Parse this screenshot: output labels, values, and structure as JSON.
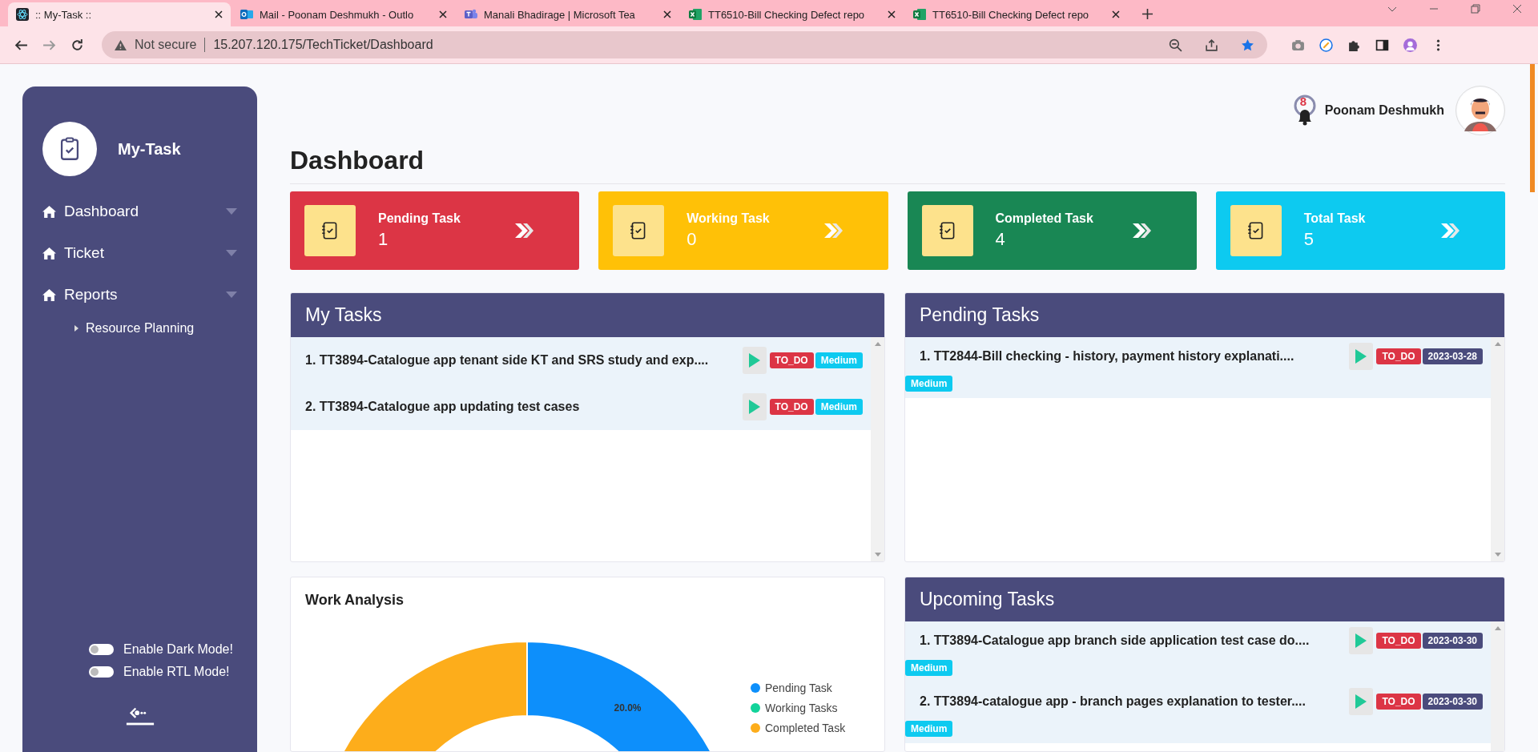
{
  "browser": {
    "tabs": [
      {
        "title": ":: My-Task ::",
        "kind": "app",
        "selected": true
      },
      {
        "title": "Mail - Poonam Deshmukh - Outlo",
        "kind": "mail",
        "selected": false
      },
      {
        "title": "Manali Bhadirage | Microsoft Tea",
        "kind": "chat",
        "selected": false
      },
      {
        "title": "TT6510-Bill Checking Defect repo",
        "kind": "sheet",
        "selected": false
      },
      {
        "title": "TT6510-Bill Checking Defect repo",
        "kind": "sheet",
        "selected": false
      }
    ],
    "security": "Not secure",
    "url": "15.207.120.175/TechTicket/Dashboard"
  },
  "sidebar": {
    "brand": "My-Task",
    "nav": [
      {
        "label": "Dashboard"
      },
      {
        "label": "Ticket"
      },
      {
        "label": "Reports",
        "children": [
          {
            "label": "Resource Planning"
          }
        ]
      }
    ],
    "toggles": [
      {
        "label": "Enable Dark Mode!",
        "on": false
      },
      {
        "label": "Enable RTL Mode!",
        "on": false
      }
    ]
  },
  "header": {
    "notifications": "8",
    "user": "Poonam Deshmukh"
  },
  "title": "Dashboard",
  "stat_cards": [
    {
      "label": "Pending Task",
      "value": "1",
      "color": "#dc3545"
    },
    {
      "label": "Working Task",
      "value": "0",
      "color": "#ffc107"
    },
    {
      "label": "Completed Task",
      "value": "4",
      "color": "#198754"
    },
    {
      "label": "Total Task",
      "value": "5",
      "color": "#0dcaf0"
    }
  ],
  "my_tasks": {
    "title": "My Tasks",
    "tasks": [
      {
        "title": "1. TT3894-Catalogue app tenant side KT and SRS study and exp....",
        "status": "TO_DO",
        "priority": "Medium"
      },
      {
        "title": "2. TT3894-Catalogue app updating test cases",
        "status": "TO_DO",
        "priority": "Medium"
      }
    ]
  },
  "pending_tasks": {
    "title": "Pending Tasks",
    "tasks": [
      {
        "title": "1. TT2844-Bill checking - history, payment history explanati....",
        "status": "TO_DO",
        "date": "2023-03-28",
        "priority": "Medium"
      }
    ]
  },
  "work_analysis": {
    "title": "Work Analysis",
    "chart_data": {
      "type": "donut",
      "legend": true,
      "categories": [
        "Pending Task",
        "Working Tasks",
        "Completed Task"
      ],
      "values": [
        20,
        0,
        80
      ],
      "colors": [
        "#0d8ffb",
        "#12d39a",
        "#fdad1b"
      ],
      "value_labels": [
        "20.0%",
        null,
        null
      ]
    }
  },
  "upcoming_tasks": {
    "title": "Upcoming Tasks",
    "tasks": [
      {
        "title": "1. TT3894-Catalogue app branch side application test case do....",
        "status": "TO_DO",
        "date": "2023-03-30",
        "priority": "Medium"
      },
      {
        "title": "2. TT3894-catalogue app - branch pages explanation to tester....",
        "status": "TO_DO",
        "date": "2023-03-30",
        "priority": "Medium"
      }
    ]
  }
}
